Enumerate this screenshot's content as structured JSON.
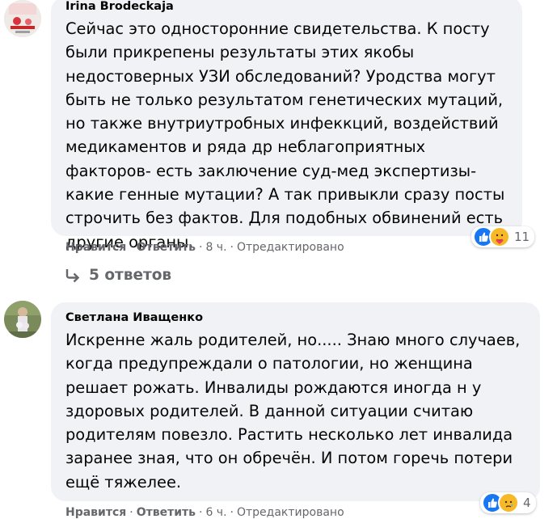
{
  "comments": [
    {
      "author": "Irina Brodeckaja",
      "text": "Сейчас это односторонние свидетельства. К посту были прикрепены результаты этих якобы недостоверных УЗИ обследований? Уродства могут быть не только результатом генетических мутаций, но также внутриутробных инфеккций, воздействий медикаментов и ряда др неблагоприятных факторов- есть заключение суд-мед экспертизы- какие генные мутации? А так привыкли сразу посты строчить без фактов. Для подобных обвинений есть другие органы.",
      "like_label": "Нравится",
      "reply_label": "Ответить",
      "time": "8 ч.",
      "edited": "Отредактировано",
      "reaction_count": "11",
      "reactions": [
        "like-icon",
        "care-icon"
      ]
    },
    {
      "author": "Светлана Иващенко",
      "text": "Искренне жаль родителей, но..... Знаю много случаев, когда предупреждали о патологии, но женщина решает рожать. Инвалиды рождаются иногда н у здоровых родителей. В данной ситуации считаю родителям повезло. Растить несколько лет инвалида заранее зная, что он обречён. И потом горечь потери ещё тяжелее.",
      "like_label": "Нравится",
      "reply_label": "Ответить",
      "time": "6 ч.",
      "edited": "Отредактировано",
      "reaction_count": "4",
      "reactions": [
        "like-icon",
        "sad-icon"
      ]
    }
  ],
  "replies_link": "5 ответов",
  "colors": {
    "bubble": "#f0f2f5",
    "secondary_text": "#65676b",
    "like_blue": "#1877f2",
    "emoji_yellow": "#f7b928"
  }
}
